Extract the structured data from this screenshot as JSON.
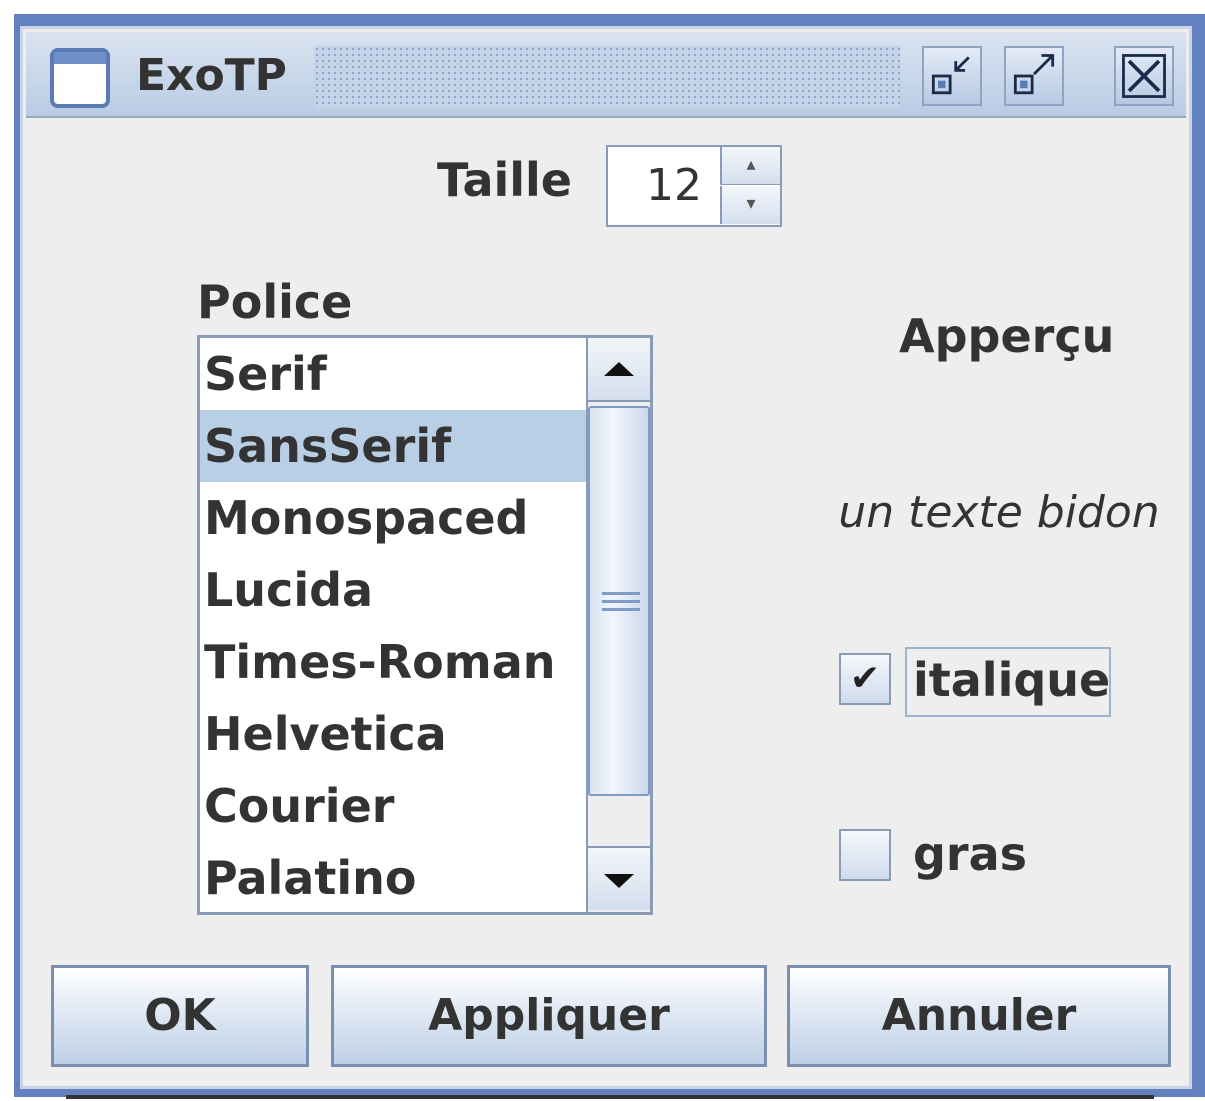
{
  "window": {
    "title": "ExoTP",
    "buttons": {
      "iconify_icon": "iconify-icon",
      "maximize_icon": "maximize-icon",
      "close_icon": "close-icon"
    }
  },
  "size": {
    "label": "Taille",
    "value": "12"
  },
  "font_list": {
    "label": "Police",
    "items": [
      "Serif",
      "SansSerif",
      "Monospaced",
      "Lucida",
      "Times-Roman",
      "Helvetica",
      "Courier",
      "Palatino"
    ],
    "selected": "SansSerif"
  },
  "preview": {
    "label": "Apperçu",
    "text": "un texte bidon"
  },
  "options": {
    "italic": {
      "label": "italique",
      "checked": true
    },
    "bold": {
      "label": "gras",
      "checked": false
    }
  },
  "buttons": {
    "ok": "OK",
    "apply": "Appliquer",
    "cancel": "Annuler"
  },
  "colors": {
    "selection": "#b8cfe5",
    "frame_border": "#6381be",
    "titlebar": "#c5d3e8"
  }
}
